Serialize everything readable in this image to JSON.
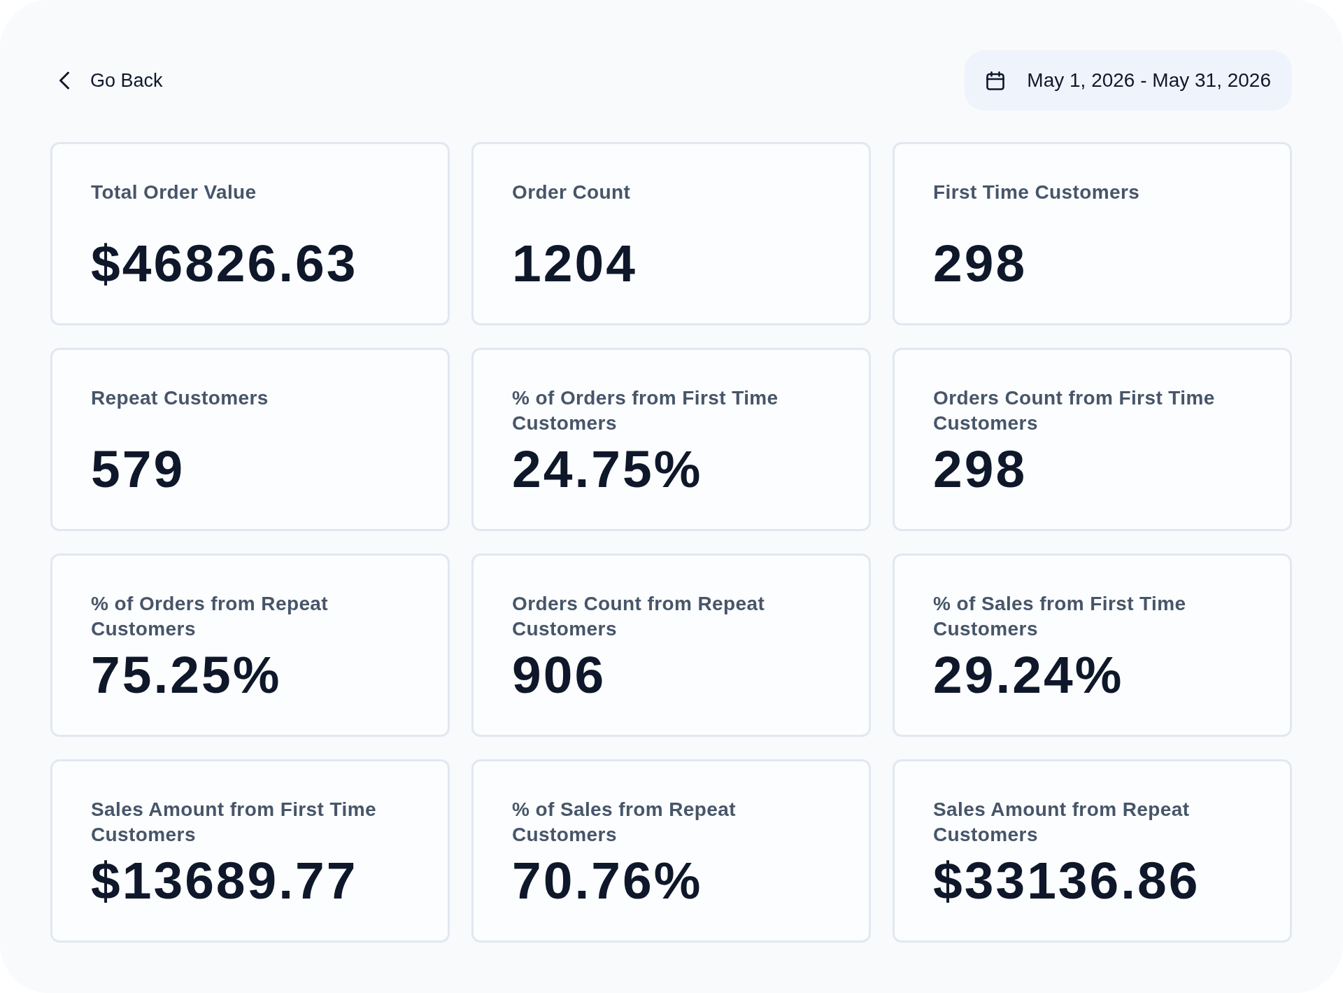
{
  "back_link": {
    "label": "Go Back"
  },
  "date_range": {
    "label": "May 1, 2026 - May 31, 2026"
  },
  "metrics": [
    {
      "label": "Total Order Value",
      "value": "$46826.63"
    },
    {
      "label": "Order Count",
      "value": "1204"
    },
    {
      "label": "First Time Customers",
      "value": "298"
    },
    {
      "label": "Repeat Customers",
      "value": "579"
    },
    {
      "label": "% of Orders from First Time Customers",
      "value": "24.75%"
    },
    {
      "label": "Orders Count from First Time Customers",
      "value": "298"
    },
    {
      "label": "% of Orders from Repeat Customers",
      "value": "75.25%"
    },
    {
      "label": "Orders Count from Repeat Customers",
      "value": "906"
    },
    {
      "label": "% of Sales from First Time Customers",
      "value": "29.24%"
    },
    {
      "label": "Sales Amount from First Time Customers",
      "value": "$13689.77"
    },
    {
      "label": "% of Sales from Repeat Customers",
      "value": "70.76%"
    },
    {
      "label": "Sales Amount from Repeat Customers",
      "value": "$33136.86"
    }
  ]
}
